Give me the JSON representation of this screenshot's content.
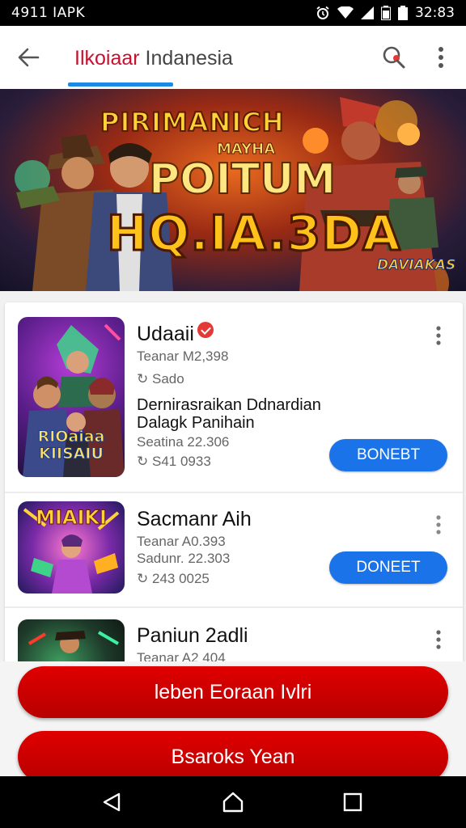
{
  "status_bar": {
    "left_text": "4911 IAPK",
    "time": "32:83"
  },
  "app_bar": {
    "title_brand": "Ilkoiaar",
    "title_rest": " Indanesia"
  },
  "banner": {
    "line1": "PIRIMANICH",
    "line2": "MAYHA",
    "line3": "POITUM",
    "line4": "HQ.IA.3DA",
    "logo_text": "DAVIAKAS"
  },
  "games": [
    {
      "title": "Udaaii",
      "meta1": "Teanar M2,398",
      "meta2": "Sado",
      "desc_line1": "Dernirasraikan Ddnardian",
      "desc_line2": "Dalagk Panihain",
      "meta3": "Seatina 22.306",
      "meta4": "S41 0933",
      "thumb_text": "RIOaiaa KIISAIU",
      "button_label": "BONEBT"
    },
    {
      "title": "Sacmanr Aih",
      "meta1": "Teanar A0.393",
      "meta2": "Sadunr. 22.303",
      "meta3": "243 0025",
      "thumb_text": "MIAIKI",
      "button_label": "DONEET"
    },
    {
      "title": "Paniun 2adli",
      "meta1": "Teanar A2 404"
    }
  ],
  "actions": {
    "primary_label": "leben Eoraan Ivlri",
    "secondary_label": "Bsaroks Yean"
  },
  "colors": {
    "accent_red": "#c8102e",
    "button_red": "#d10000",
    "button_blue": "#1a73e8",
    "tab_indicator": "#1e88e5"
  },
  "icons": {
    "back": "arrow-left-icon",
    "search": "search-icon",
    "overflow": "more-vert-icon",
    "nav_back": "triangle-back-icon",
    "nav_home": "home-icon",
    "nav_recents": "square-recents-icon"
  }
}
